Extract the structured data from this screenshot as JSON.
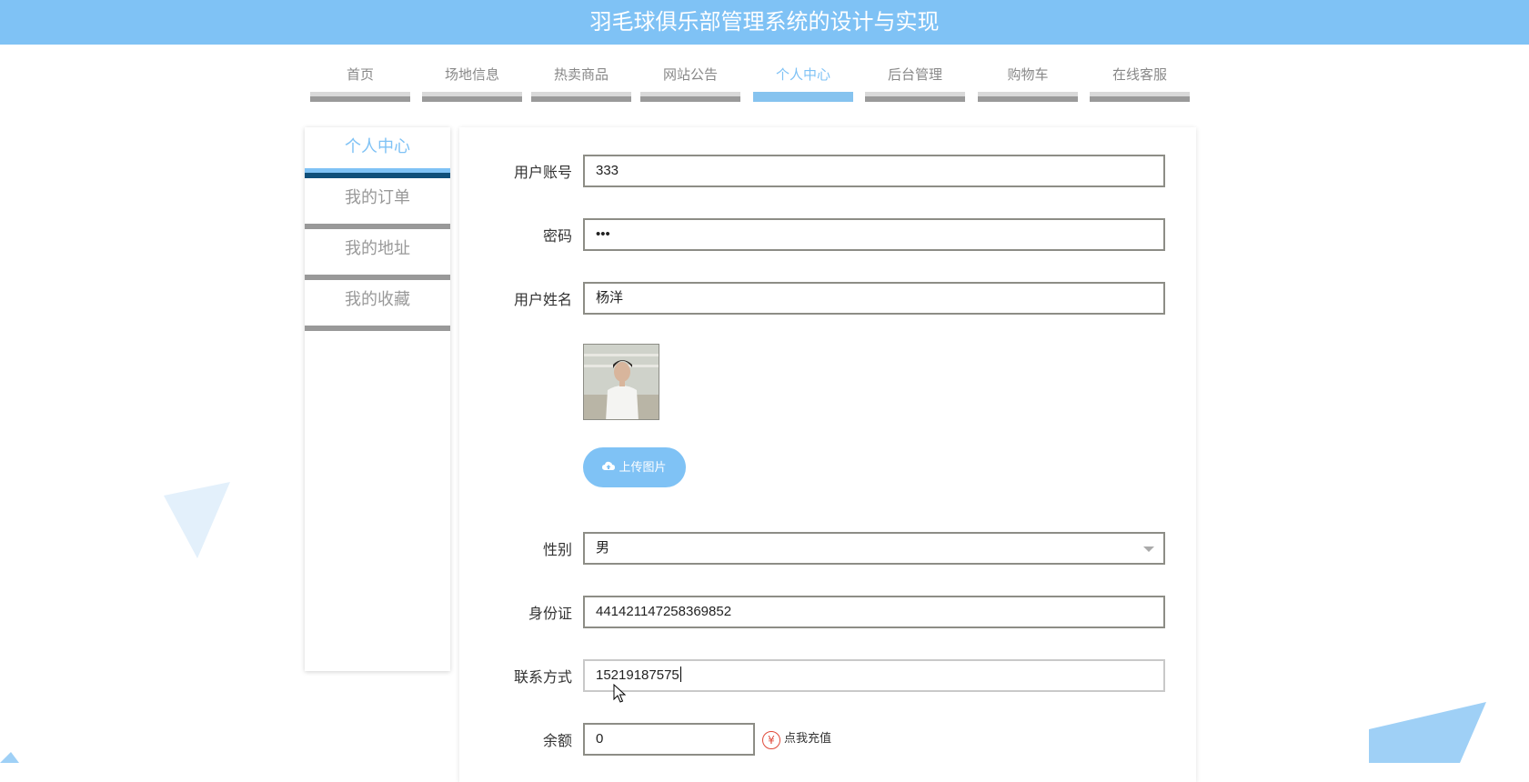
{
  "header": {
    "title": "羽毛球俱乐部管理系统的设计与实现"
  },
  "nav": {
    "items": [
      {
        "label": "首页"
      },
      {
        "label": "场地信息"
      },
      {
        "label": "热卖商品"
      },
      {
        "label": "网站公告"
      },
      {
        "label": "个人中心"
      },
      {
        "label": "后台管理"
      },
      {
        "label": "购物车"
      },
      {
        "label": "在线客服"
      }
    ],
    "active": "个人中心",
    "accent_color": "#7fc2f5"
  },
  "sidebar": {
    "items": [
      {
        "label": "个人中心"
      },
      {
        "label": "我的订单"
      },
      {
        "label": "我的地址"
      },
      {
        "label": "我的收藏"
      }
    ],
    "active": "个人中心"
  },
  "form": {
    "account_label": "用户账号",
    "account_value": "333",
    "password_label": "密码",
    "password_value": "•••",
    "name_label": "用户姓名",
    "name_value": "杨洋",
    "upload_label": "上传图片",
    "gender_label": "性别",
    "gender_value": "男",
    "idcard_label": "身份证",
    "idcard_value": "441421147258369852",
    "phone_label": "联系方式",
    "phone_value": "15219187575",
    "balance_label": "余额",
    "balance_value": "0",
    "recharge_label": "点我充值"
  },
  "icons": {
    "upload": "cloud-upload-icon",
    "recharge": "yen-circle-icon",
    "select": "chevron-down-icon"
  }
}
